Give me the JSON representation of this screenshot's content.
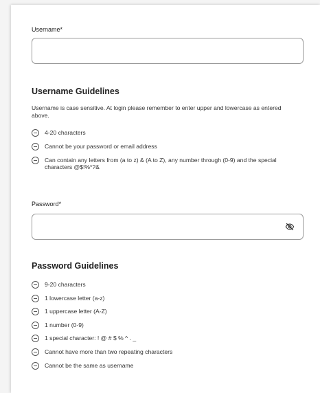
{
  "username": {
    "label": "Username*",
    "value": "",
    "placeholder": ""
  },
  "username_guidelines": {
    "heading": "Username Guidelines",
    "description": "Username is case sensitive. At login please remember to enter upper and lowercase as entered above.",
    "rules": [
      "4-20 characters",
      "Cannot be your password or email address",
      "Can contain any letters from (a to z) & (A to Z), any number through (0-9) and the special characters @$!%*?&"
    ]
  },
  "password": {
    "label": "Password*",
    "value": "",
    "placeholder": "",
    "toggle_icon": "eye-slash-icon"
  },
  "password_guidelines": {
    "heading": "Password Guidelines",
    "rules": [
      "9-20 characters",
      "1 lowercase letter (a-z)",
      "1 uppercase letter (A-Z)",
      "1 number (0-9)",
      "1 special character: ! @ # $ % ^ . _",
      "Cannot have more than two repeating characters",
      "Cannot be the same as username"
    ]
  },
  "colors": {
    "border": "#9a9a9a",
    "text": "#333333",
    "background": "#ffffff"
  }
}
